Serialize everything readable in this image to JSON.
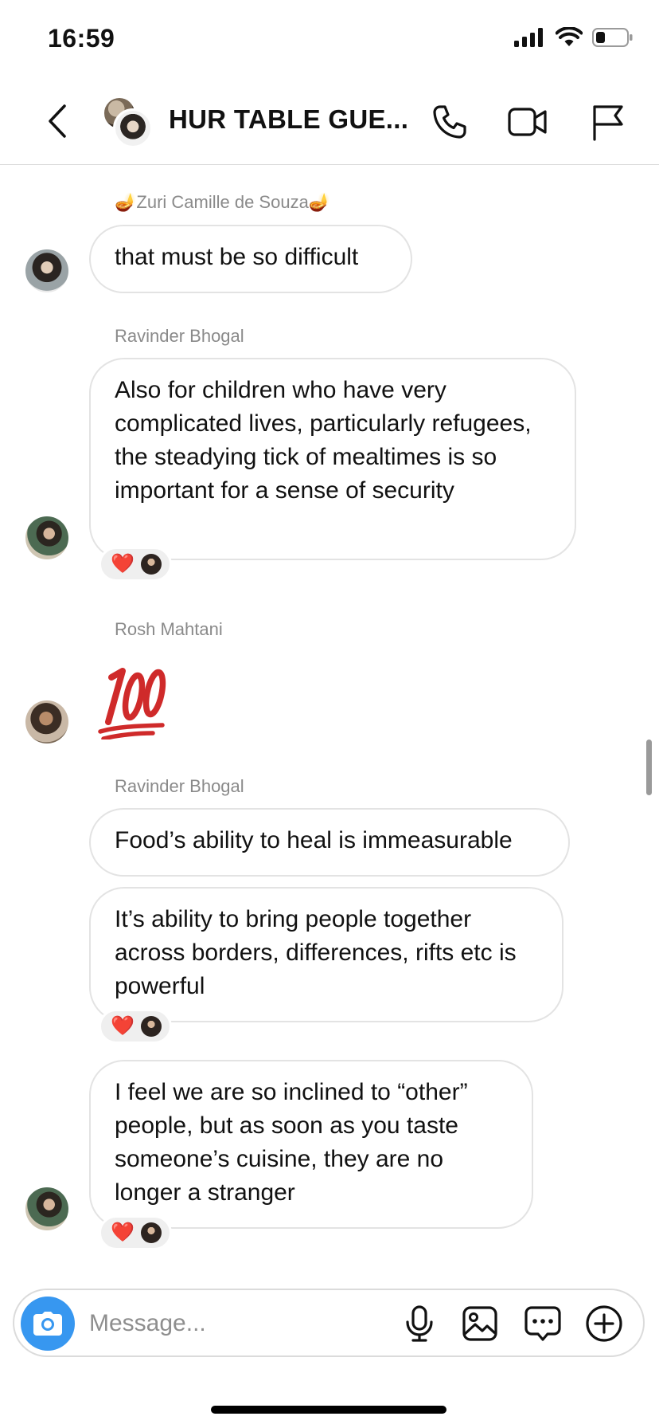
{
  "status_bar": {
    "time": "16:59"
  },
  "header": {
    "title": "HUR TABLE GUE..."
  },
  "messages": [
    {
      "sender": "🪔Zuri Camille de Souza🪔",
      "text": "that must be so difficult"
    },
    {
      "sender": "Ravinder Bhogal",
      "text": "Also for children who have very complicated lives, particularly refugees, the steadying tick of mealtimes is so important for a sense of security",
      "reaction": "❤️"
    },
    {
      "sender": "Rosh Mahtani",
      "text": "💯"
    },
    {
      "sender": "Ravinder Bhogal",
      "text": "Food’s ability to heal is immeasurable"
    },
    {
      "text": "It’s ability to bring people together across borders, differences, rifts etc is powerful",
      "reaction": "❤️"
    },
    {
      "text": "I feel we are so inclined to “other” people, but as soon as you taste someone’s cuisine, they are no longer a stranger",
      "reaction": "❤️"
    }
  ],
  "composer": {
    "placeholder": "Message..."
  }
}
